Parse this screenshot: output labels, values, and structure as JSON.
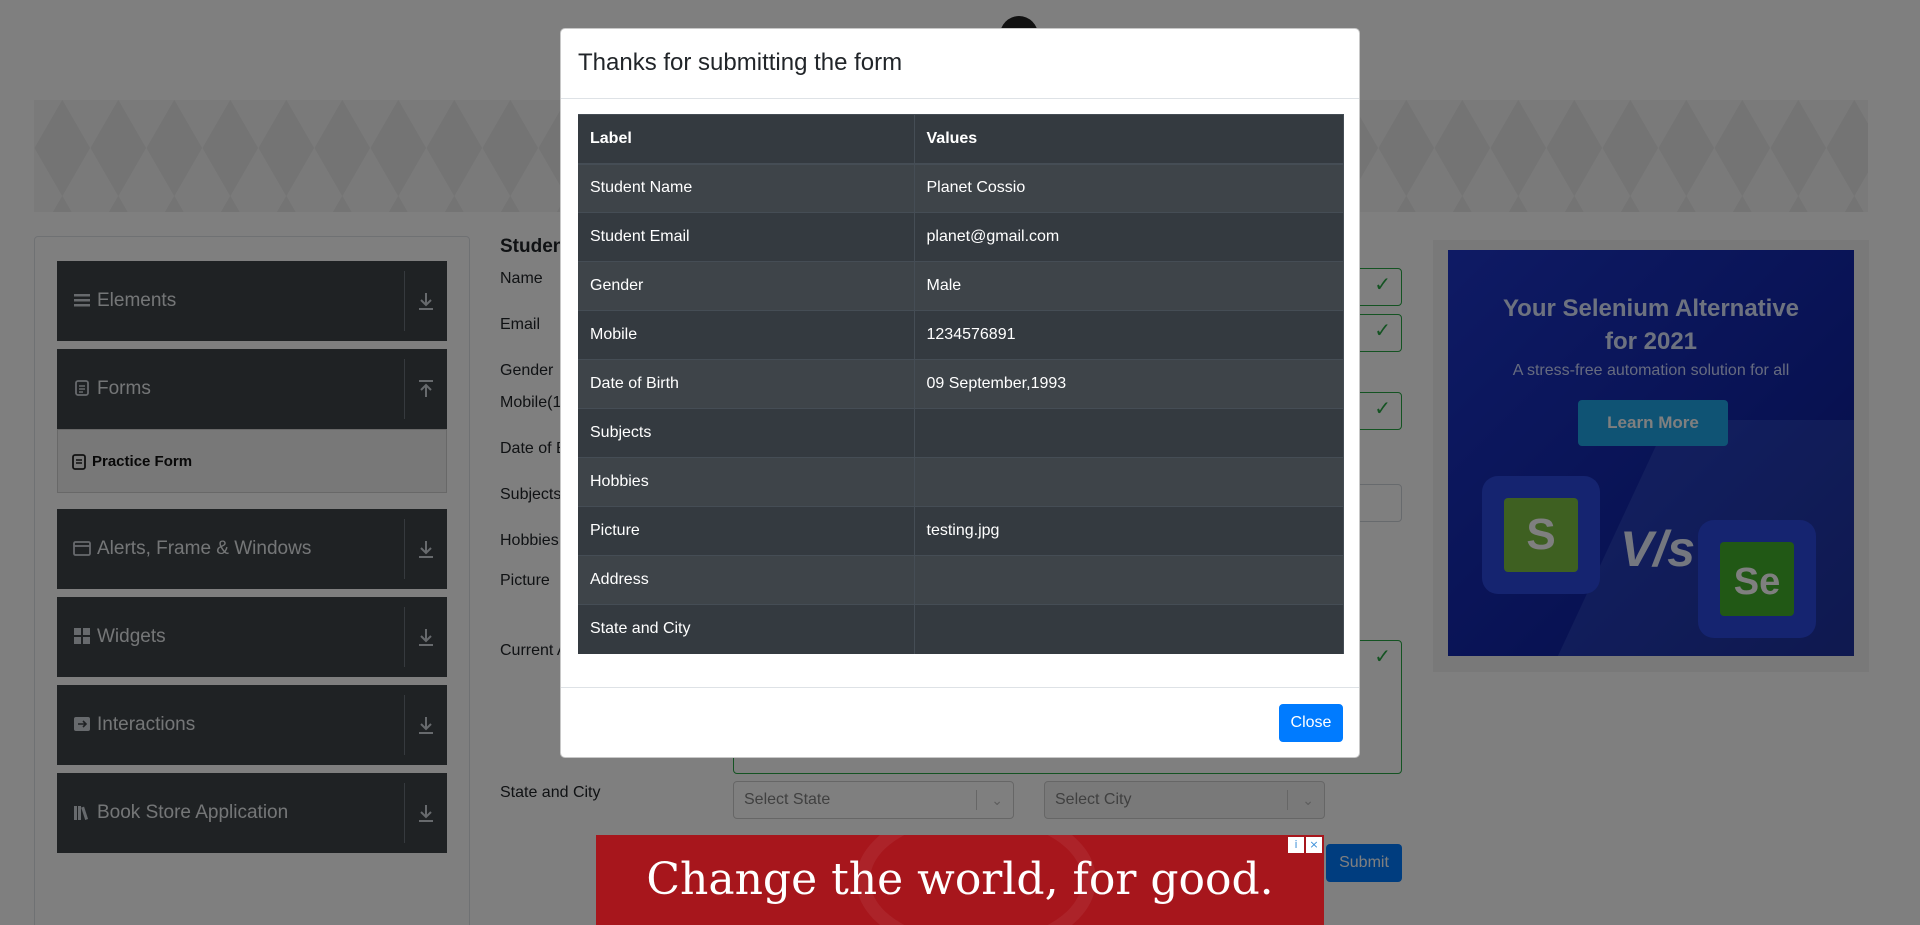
{
  "sidebar": {
    "groups": [
      {
        "label": "Elements",
        "icon": "list-icon",
        "arrow": "download"
      },
      {
        "label": "Forms",
        "icon": "document-icon",
        "arrow": "upload"
      },
      {
        "label": "Alerts, Frame & Windows",
        "icon": "window-icon",
        "arrow": "download"
      },
      {
        "label": "Widgets",
        "icon": "grid-icon",
        "arrow": "download"
      },
      {
        "label": "Interactions",
        "icon": "interaction-icon",
        "arrow": "download"
      },
      {
        "label": "Book Store Application",
        "icon": "books-icon",
        "arrow": "download"
      }
    ],
    "active_item": "Practice Form"
  },
  "form": {
    "title": "Student",
    "labels": {
      "name": "Name",
      "email": "Email",
      "gender": "Gender",
      "mobile": "Mobile(1",
      "dob": "Date of B",
      "subjects": "Subjects",
      "hobbies": "Hobbies",
      "picture": "Picture",
      "current_address": "Current A",
      "state_city": "State and City"
    },
    "state_placeholder": "Select State",
    "city_placeholder": "Select City",
    "submit_label": "Submit"
  },
  "side_ad": {
    "title_line1": "Your Selenium Alternative",
    "title_line2": "for 2021",
    "subtitle": "A stress-free automation solution for all",
    "button": "Learn More",
    "vs": "V/s",
    "logo_left": "S",
    "logo_right": "Se"
  },
  "modal": {
    "title": "Thanks for submitting the form",
    "columns": [
      "Label",
      "Values"
    ],
    "rows": [
      {
        "label": "Student Name",
        "value": "Planet Cossio"
      },
      {
        "label": "Student Email",
        "value": "planet@gmail.com"
      },
      {
        "label": "Gender",
        "value": "Male"
      },
      {
        "label": "Mobile",
        "value": "1234576891"
      },
      {
        "label": "Date of Birth",
        "value": "09 September,1993"
      },
      {
        "label": "Subjects",
        "value": ""
      },
      {
        "label": "Hobbies",
        "value": ""
      },
      {
        "label": "Picture",
        "value": "testing.jpg"
      },
      {
        "label": "Address",
        "value": ""
      },
      {
        "label": "State and City",
        "value": ""
      }
    ],
    "close_label": "Close"
  },
  "bottom_ad": {
    "text": "Change the world, for good.",
    "info_glyph": "i",
    "close_glyph": "×"
  },
  "colors": {
    "primary": "#007bff",
    "success": "#28a745",
    "table_dark": "#343a40",
    "sidebar_dark": "#3f4448",
    "ad_red": "#a7161c"
  }
}
